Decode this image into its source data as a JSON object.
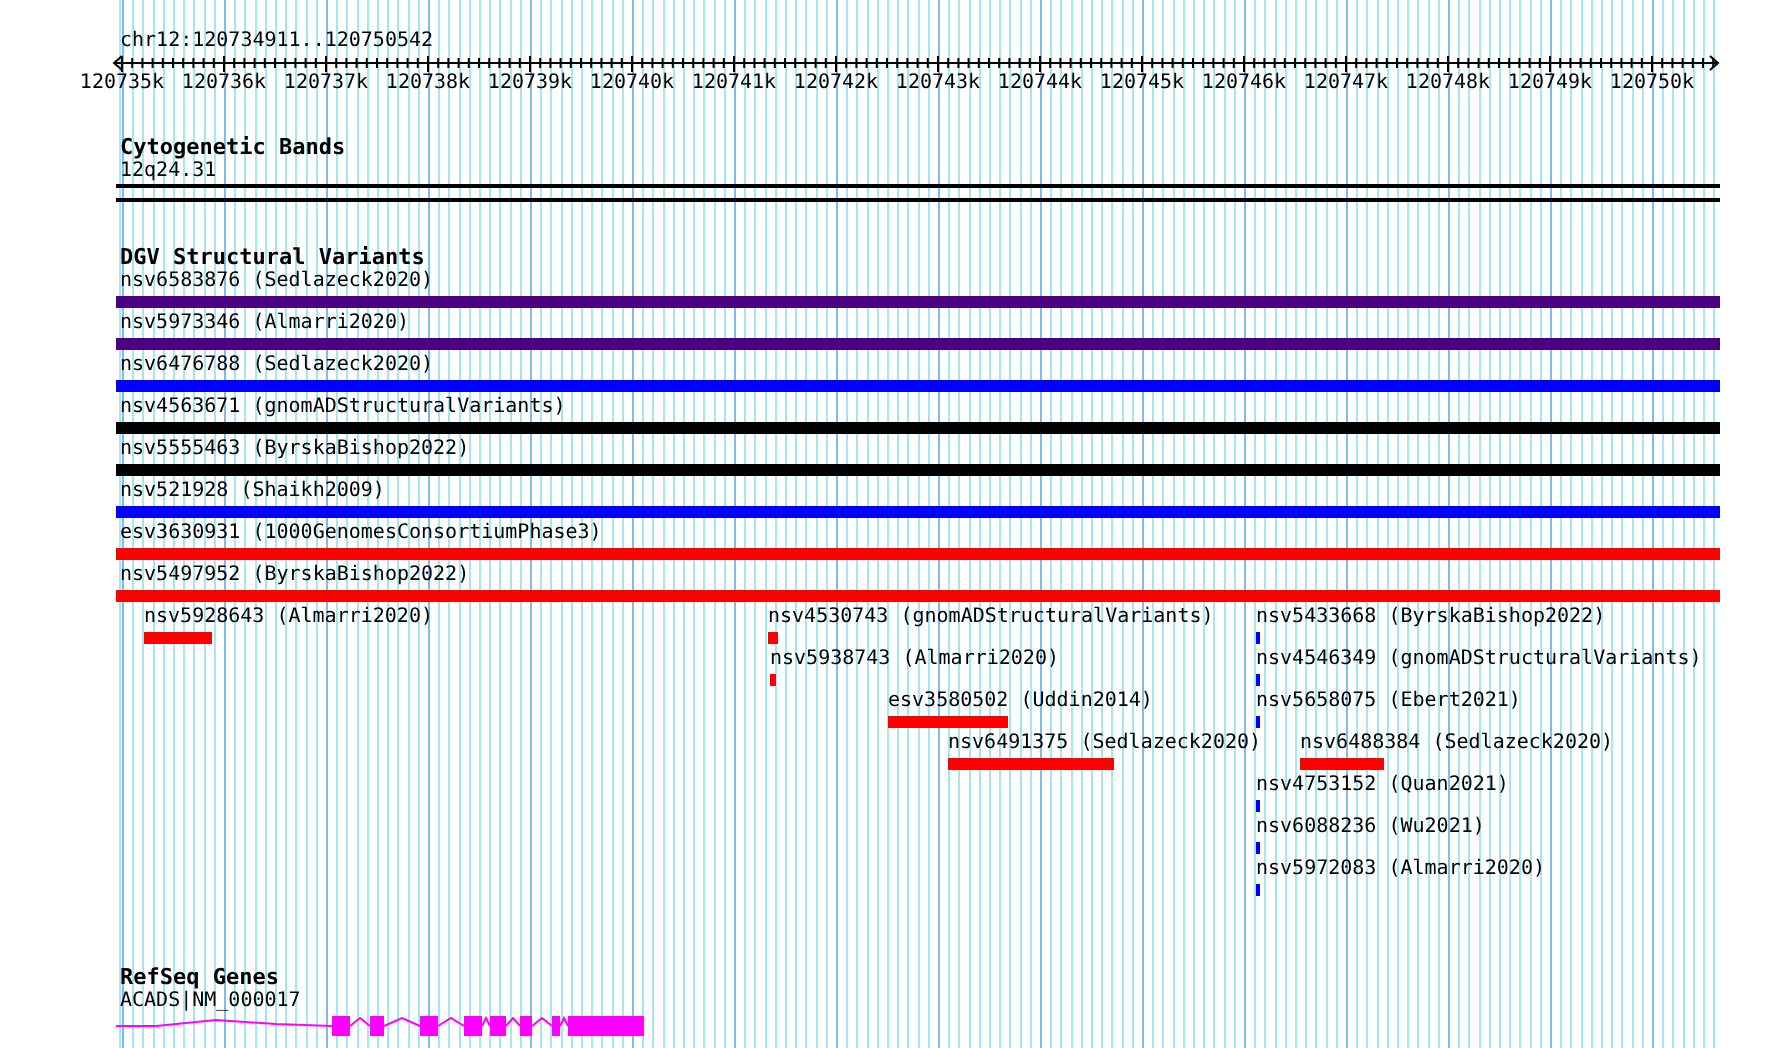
{
  "location": "chr12:120734911..120750542",
  "ruler": {
    "ticks": [
      "120735k",
      "120736k",
      "120737k",
      "120738k",
      "120739k",
      "120740k",
      "120741k",
      "120742k",
      "120743k",
      "120744k",
      "120745k",
      "120746k",
      "120747k",
      "120748k",
      "120749k",
      "120750k"
    ]
  },
  "tracks": [
    {
      "kind": "bands",
      "title": "Cytogenetic Bands",
      "features": [
        {
          "label": "12q24.31",
          "color": "#000000"
        }
      ]
    },
    {
      "kind": "variants",
      "title": "DGV Structural Variants",
      "features": [
        {
          "label": "nsv6583876 (Sedlazeck2020)",
          "color": "#4b0082"
        },
        {
          "label": "nsv5973346 (Almarri2020)",
          "color": "#4b0082"
        },
        {
          "label": "nsv6476788 (Sedlazeck2020)",
          "color": "#0000ff"
        },
        {
          "label": "nsv4563671 (gnomADStructuralVariants)",
          "color": "#000000"
        },
        {
          "label": "nsv5555463 (ByrskaBishop2022)",
          "color": "#000000"
        },
        {
          "label": "nsv521928 (Shaikh2009)",
          "color": "#0000ff"
        },
        {
          "label": "esv3630931 (1000GenomesConsortiumPhase3)",
          "color": "#ff0000"
        },
        {
          "label": "nsv5497952 (ByrskaBishop2022)",
          "color": "#ff0000"
        },
        {
          "label": "nsv5928643 (Almarri2020)",
          "color": "#ff0000"
        },
        {
          "label": "nsv4530743 (gnomADStructuralVariants)",
          "color": "#ff0000"
        },
        {
          "label": "nsv5938743 (Almarri2020)",
          "color": "#ff0000"
        },
        {
          "label": "esv3580502 (Uddin2014)",
          "color": "#ff0000"
        },
        {
          "label": "nsv6491375 (Sedlazeck2020)",
          "color": "#ff0000"
        },
        {
          "label": "nsv5433668 (ByrskaBishop2022)",
          "color": "#0000ff"
        },
        {
          "label": "nsv4546349 (gnomADStructuralVariants)",
          "color": "#0000ff"
        },
        {
          "label": "nsv5658075 (Ebert2021)",
          "color": "#0000ff"
        },
        {
          "label": "nsv6488384 (Sedlazeck2020)",
          "color": "#ff0000"
        },
        {
          "label": "nsv4753152 (Quan2021)",
          "color": "#0000ff"
        },
        {
          "label": "nsv6088236 (Wu2021)",
          "color": "#0000ff"
        },
        {
          "label": "nsv5972083 (Almarri2020)",
          "color": "#0000ff"
        }
      ]
    },
    {
      "kind": "genes",
      "title": "RefSeq Genes",
      "features": [
        {
          "label": "ACADS|NM_000017",
          "color": "#ff00ff"
        }
      ]
    }
  ]
}
